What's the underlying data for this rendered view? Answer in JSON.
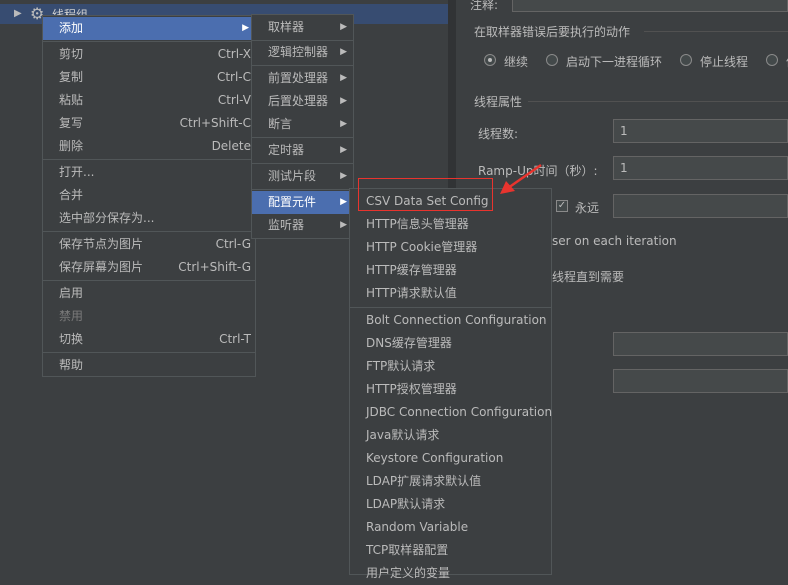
{
  "tree": {
    "label": "线程组"
  },
  "right": {
    "comment_label": "注释:",
    "error_action_label": "在取样器错误后要执行的动作",
    "radios": [
      "继续",
      "启动下一进程循环",
      "停止线程",
      "停"
    ],
    "thread_props_label": "线程属性",
    "threads_label": "线程数:",
    "threads_value": "1",
    "rampup_label": "Ramp-Up时间（秒）:",
    "rampup_value": "1",
    "forever_label": "永远",
    "same_user_text": "ser on each iteration",
    "delay_text": "线程直到需要",
    "sched_a": ")",
    "sched_b": ")"
  },
  "menu": [
    {
      "label": "添加",
      "submenu": true
    },
    {
      "label": "剪切",
      "shortcut": "Ctrl-X"
    },
    {
      "label": "复制",
      "shortcut": "Ctrl-C"
    },
    {
      "label": "粘贴",
      "shortcut": "Ctrl-V"
    },
    {
      "label": "复写",
      "shortcut": "Ctrl+Shift-C"
    },
    {
      "label": "删除",
      "shortcut": "Delete"
    },
    {
      "label": "打开..."
    },
    {
      "label": "合并"
    },
    {
      "label": "选中部分保存为..."
    },
    {
      "label": "保存节点为图片",
      "shortcut": "Ctrl-G"
    },
    {
      "label": "保存屏幕为图片",
      "shortcut": "Ctrl+Shift-G"
    },
    {
      "label": "启用"
    },
    {
      "label": "禁用"
    },
    {
      "label": "切换",
      "shortcut": "Ctrl-T"
    },
    {
      "label": "帮助"
    }
  ],
  "submenu": [
    {
      "label": "取样器"
    },
    {
      "label": "逻辑控制器"
    },
    {
      "label": "前置处理器"
    },
    {
      "label": "后置处理器"
    },
    {
      "label": "断言"
    },
    {
      "label": "定时器"
    },
    {
      "label": "测试片段"
    },
    {
      "label": "配置元件"
    },
    {
      "label": "监听器"
    }
  ],
  "config_menu": [
    {
      "label": "CSV Data Set Config"
    },
    {
      "label": "HTTP信息头管理器"
    },
    {
      "label": "HTTP Cookie管理器"
    },
    {
      "label": "HTTP缓存管理器"
    },
    {
      "label": "HTTP请求默认值"
    },
    {
      "label": "Bolt Connection Configuration"
    },
    {
      "label": "DNS缓存管理器"
    },
    {
      "label": "FTP默认请求"
    },
    {
      "label": "HTTP授权管理器"
    },
    {
      "label": "JDBC Connection Configuration"
    },
    {
      "label": "Java默认请求"
    },
    {
      "label": "Keystore Configuration"
    },
    {
      "label": "LDAP扩展请求默认值"
    },
    {
      "label": "LDAP默认请求"
    },
    {
      "label": "Random Variable"
    },
    {
      "label": "TCP取样器配置"
    },
    {
      "label": "用户定义的变量"
    }
  ],
  "colors": {
    "highlight": "#4b6eaf",
    "annotation": "#e8342e"
  }
}
